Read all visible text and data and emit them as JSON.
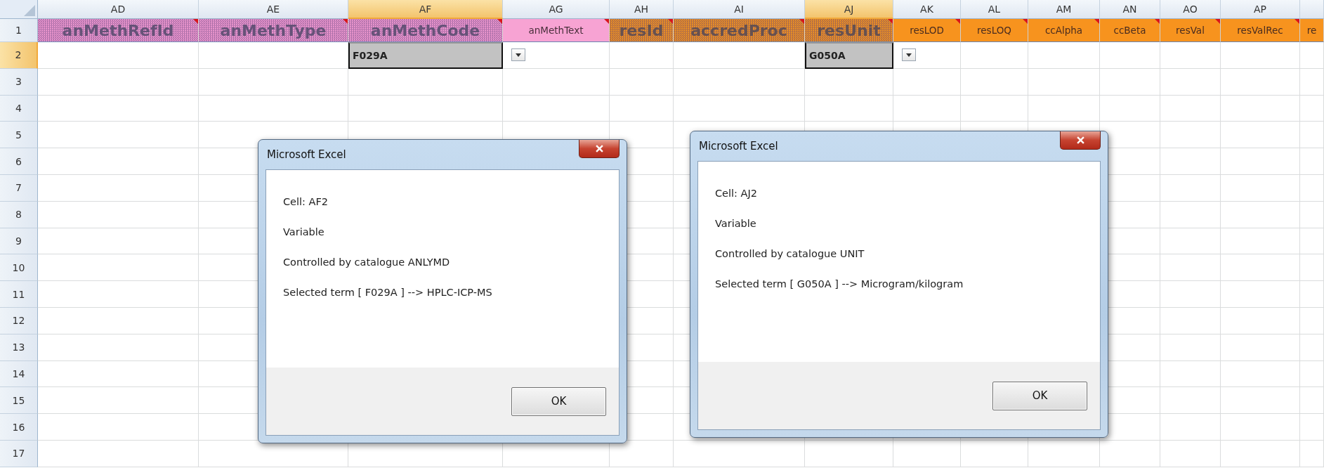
{
  "columns": [
    {
      "label": "AD",
      "selected": false
    },
    {
      "label": "AE",
      "selected": false
    },
    {
      "label": "AF",
      "selected": true
    },
    {
      "label": "AG",
      "selected": false
    },
    {
      "label": "AH",
      "selected": false
    },
    {
      "label": "AI",
      "selected": false
    },
    {
      "label": "AJ",
      "selected": true
    },
    {
      "label": "AK",
      "selected": false
    },
    {
      "label": "AL",
      "selected": false
    },
    {
      "label": "AM",
      "selected": false
    },
    {
      "label": "AN",
      "selected": false
    },
    {
      "label": "AO",
      "selected": false
    },
    {
      "label": "AP",
      "selected": false
    },
    {
      "selected": false
    }
  ],
  "rows": [
    {
      "label": "1",
      "selected": false
    },
    {
      "label": "2",
      "selected": true
    },
    {
      "label": "3",
      "selected": false
    },
    {
      "label": "4",
      "selected": false
    },
    {
      "label": "5",
      "selected": false
    },
    {
      "label": "6",
      "selected": false
    },
    {
      "label": "7",
      "selected": false
    },
    {
      "label": "8",
      "selected": false
    },
    {
      "label": "9",
      "selected": false
    },
    {
      "label": "10",
      "selected": false
    },
    {
      "label": "11",
      "selected": false
    },
    {
      "label": "12",
      "selected": false
    },
    {
      "label": "13",
      "selected": false
    },
    {
      "label": "14",
      "selected": false
    },
    {
      "label": "15",
      "selected": false
    },
    {
      "label": "16",
      "selected": false
    },
    {
      "label": "17",
      "selected": false
    }
  ],
  "header_row": [
    {
      "text": "anMethRefId",
      "kind": "hatched",
      "color": "#f29ad2",
      "comment": true
    },
    {
      "text": "anMethType",
      "kind": "hatched",
      "color": "#f29ad2",
      "comment": true
    },
    {
      "text": "anMethCode",
      "kind": "hatched",
      "color": "#f29ad2",
      "comment": true
    },
    {
      "text": "anMethText",
      "kind": "plain",
      "color": "#f7a3d3",
      "comment": true
    },
    {
      "text": "resId",
      "kind": "hatched",
      "color": "#f29420",
      "comment": true
    },
    {
      "text": "accredProc",
      "kind": "hatched",
      "color": "#f29420",
      "comment": true
    },
    {
      "text": "resUnit",
      "kind": "hatched",
      "color": "#f29420",
      "comment": true
    },
    {
      "text": "resLOD",
      "kind": "plain",
      "color": "#f7931e",
      "comment": true
    },
    {
      "text": "resLOQ",
      "kind": "plain",
      "color": "#f7931e",
      "comment": true
    },
    {
      "text": "ccAlpha",
      "kind": "plain",
      "color": "#f7931e",
      "comment": true
    },
    {
      "text": "ccBeta",
      "kind": "plain",
      "color": "#f7931e",
      "comment": true
    },
    {
      "text": "resVal",
      "kind": "plain",
      "color": "#f7931e",
      "comment": true
    },
    {
      "text": "resValRec",
      "kind": "plain",
      "color": "#f7931e",
      "comment": true
    },
    {
      "text": "re",
      "kind": "plain",
      "color": "#f7931e",
      "comment": false
    }
  ],
  "row_2": [
    {
      "selected": false
    },
    {
      "selected": false
    },
    {
      "value": "F029A",
      "selected": true,
      "dropdown": true
    },
    {
      "selected": false
    },
    {
      "selected": false
    },
    {
      "selected": false
    },
    {
      "value": "G050A",
      "selected": true,
      "dropdown": true
    },
    {
      "selected": false
    },
    {
      "selected": false
    },
    {
      "selected": false
    },
    {
      "selected": false
    },
    {
      "selected": false
    },
    {
      "selected": false
    },
    {
      "selected": false
    }
  ],
  "dialogs": [
    {
      "title": "Microsoft Excel",
      "lines": [
        "Cell: AF2",
        "Variable",
        "Controlled by catalogue ANLYMD",
        "Selected term [ F029A ] --> HPLC-ICP-MS"
      ],
      "button": "OK"
    },
    {
      "title": "Microsoft Excel",
      "lines": [
        "Cell: AJ2",
        "Variable",
        "Controlled by catalogue UNIT",
        "Selected term [ G050A ] --> Microgram/kilogram"
      ],
      "button": "OK"
    }
  ]
}
